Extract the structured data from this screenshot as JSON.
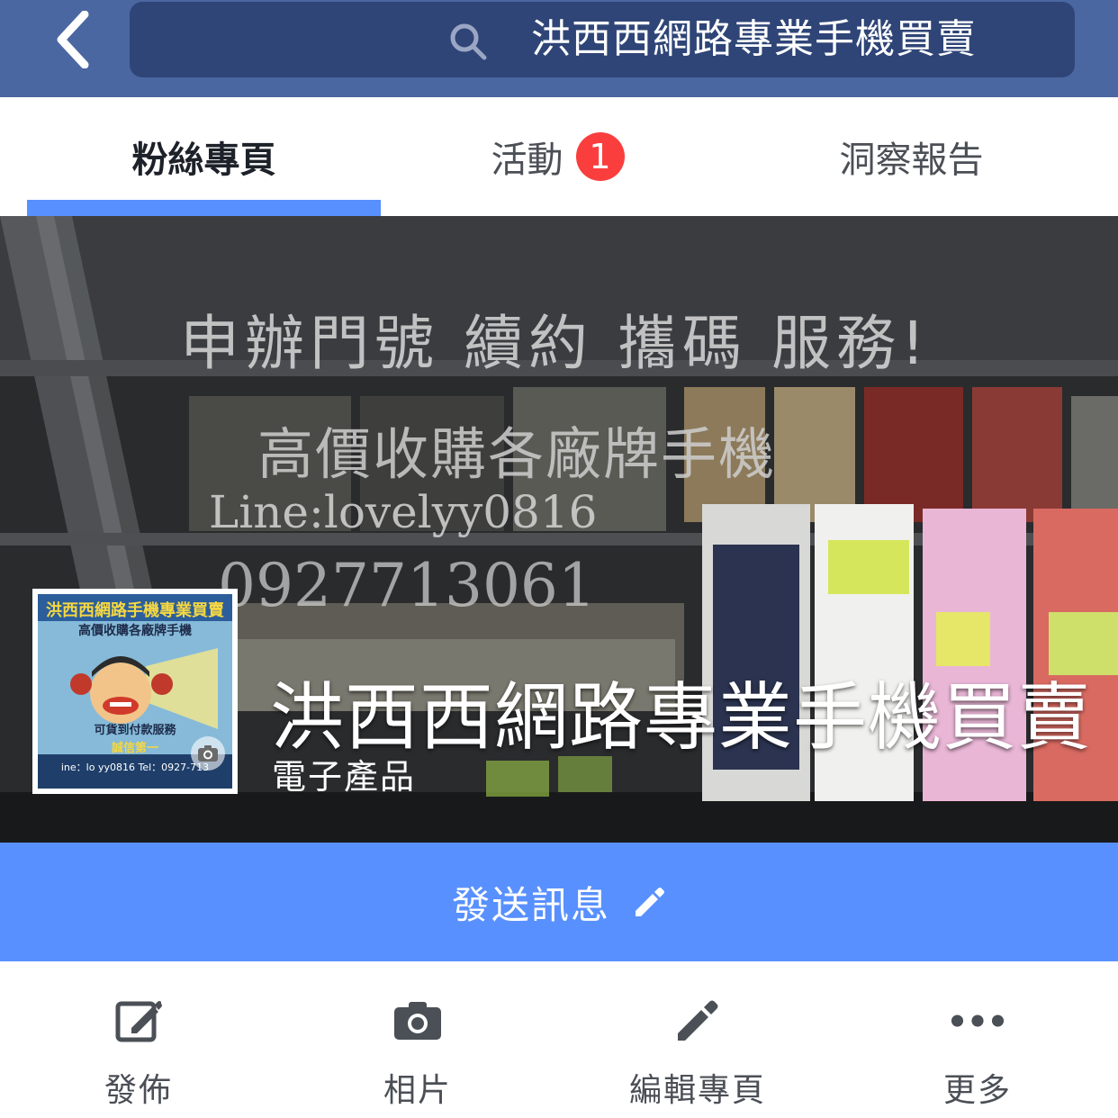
{
  "header": {
    "back_icon": "back-chevron-icon",
    "search_icon": "search-icon",
    "search_text": "洪西西網路專業手機買賣"
  },
  "tabs": [
    {
      "label": "粉絲專頁",
      "active": true
    },
    {
      "label": "活動",
      "badge": "1"
    },
    {
      "label": "洞察報告"
    }
  ],
  "cover": {
    "lines": [
      "申辦門號 續約 攜碼 服務!",
      "高價收購各廠牌手機",
      "Line:lovelyy0816",
      "0927713061"
    ],
    "profile_picture": {
      "title": "洪西西網路手機專業買賣",
      "subtitle": "高價收購各廠牌手機",
      "line3": "可貨到付款服務",
      "line4": "誠信第一",
      "contact": "ine：lo  yy0816   Tel：0927-713"
    },
    "page_name": "洪西西網路專業手機買賣",
    "category": "電子產品"
  },
  "send_message": {
    "label": "發送訊息",
    "icon": "pencil-icon"
  },
  "actions": [
    {
      "label": "發佈",
      "icon": "compose-icon"
    },
    {
      "label": "相片",
      "icon": "camera-icon"
    },
    {
      "label": "編輯專頁",
      "icon": "pencil-icon"
    },
    {
      "label": "更多",
      "icon": "more-dots-icon"
    }
  ],
  "colors": {
    "header_bg": "#4b67a1",
    "search_bg": "#2f4577",
    "accent": "#5890ff",
    "badge": "#fa3e3e",
    "icon_gray": "#4b4f56"
  }
}
